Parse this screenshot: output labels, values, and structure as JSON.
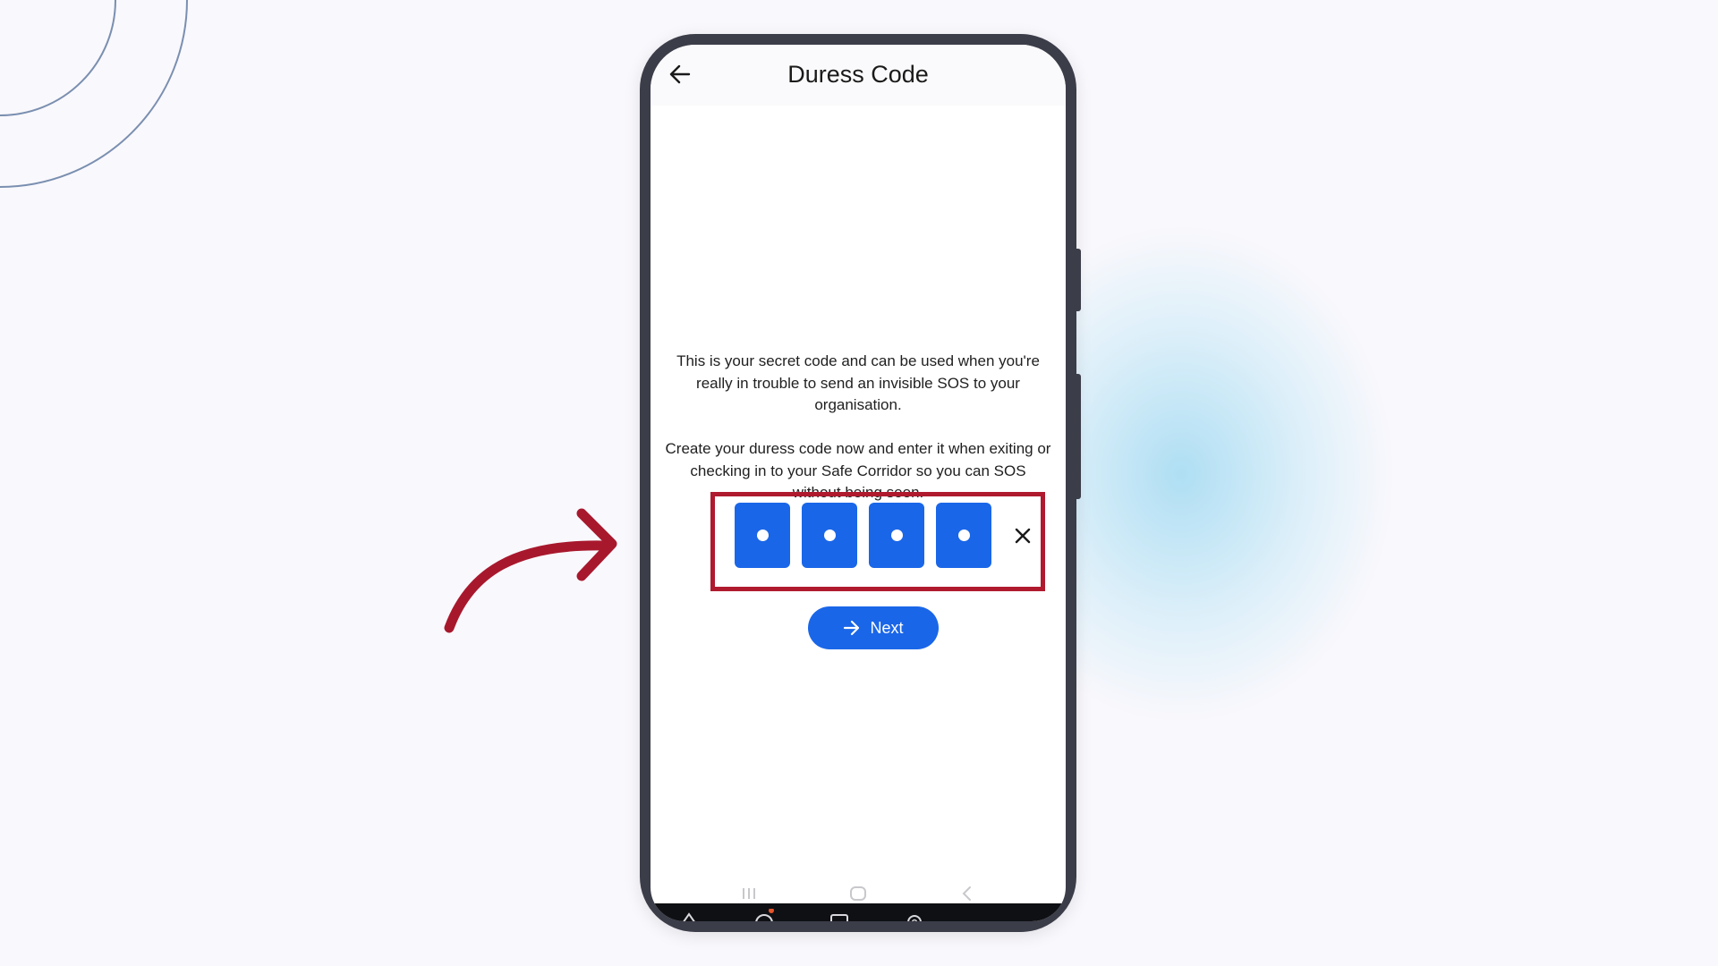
{
  "screen": {
    "title": "Duress Code",
    "back_icon": "arrow-left-icon",
    "paragraph1": "This is your secret code and can be used when you're really in trouble to send an invisible SOS to your organisation.",
    "paragraph2": "Create your duress code now and enter it when exiting or checking in to your Safe Corridor so you can SOS without being seen.",
    "code_length": 4,
    "code_filled": 4,
    "clear_icon": "close-icon",
    "next_button": {
      "label": "Next",
      "icon": "arrow-right-icon"
    }
  },
  "system_nav": [
    "recent-apps-icon",
    "home-icon",
    "back-chevron-icon"
  ],
  "tab_bar": [
    "home-tab-icon",
    "chat-tab-icon",
    "vehicle-tab-icon",
    "settings-tab-icon"
  ],
  "colors": {
    "accent": "#1a66e8",
    "highlight": "#b01a2e",
    "background": "#f9f8fc",
    "phone_frame": "#3b3d49"
  }
}
